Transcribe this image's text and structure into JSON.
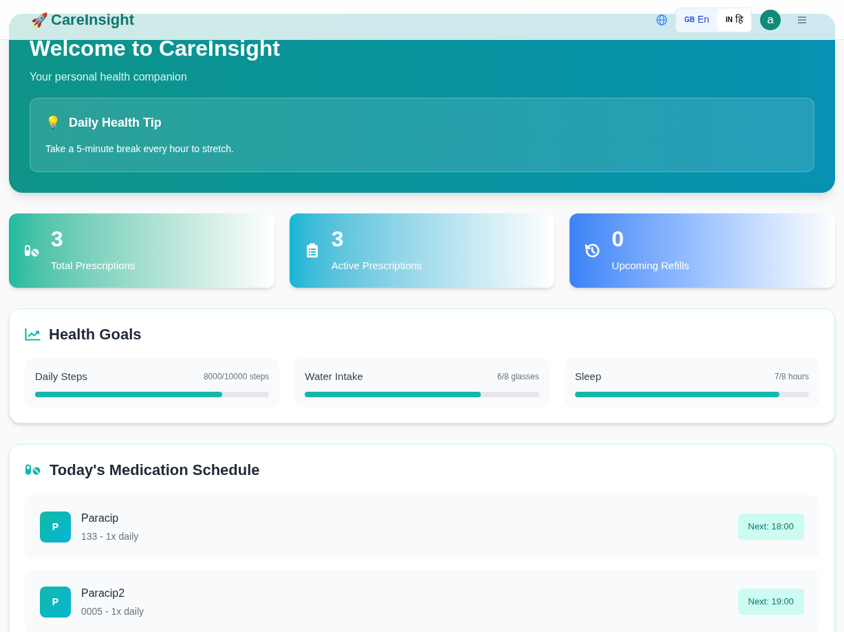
{
  "header": {
    "logo_icon": "🚀",
    "brand": "CareInsight",
    "languages": [
      {
        "code": "GB",
        "label": "En",
        "selected": true
      },
      {
        "code": "IN",
        "label": "हि",
        "selected": false
      }
    ],
    "avatar": "a"
  },
  "hero": {
    "title": "Welcome to CareInsight",
    "subtitle": "Your personal health companion",
    "tip": {
      "icon": "💡",
      "title": "Daily Health Tip",
      "text": "Take a 5-minute break every hour to stretch."
    }
  },
  "stats": [
    {
      "kind": "pills",
      "value": "3",
      "label": "Total Prescriptions"
    },
    {
      "kind": "clipboard",
      "value": "3",
      "label": "Active Prescriptions"
    },
    {
      "kind": "history",
      "value": "0",
      "label": "Upcoming Refills"
    }
  ],
  "goals": {
    "title": "Health Goals",
    "items": [
      {
        "name": "Daily Steps",
        "reading": "8000/10000 steps",
        "level": 0.8
      },
      {
        "name": "Water Intake",
        "reading": "6/8 glasses",
        "level": 0.75
      },
      {
        "name": "Sleep",
        "reading": "7/8 hours",
        "level": 0.875
      }
    ]
  },
  "schedule": {
    "title": "Today's Medication Schedule",
    "items": [
      {
        "initial": "P",
        "name": "Paracip",
        "detail": "133 - 1x daily",
        "next": "Next: 18:00"
      },
      {
        "initial": "P",
        "name": "Paracip2",
        "detail": "0005 - 1x daily",
        "next": "Next: 19:00"
      }
    ]
  }
}
